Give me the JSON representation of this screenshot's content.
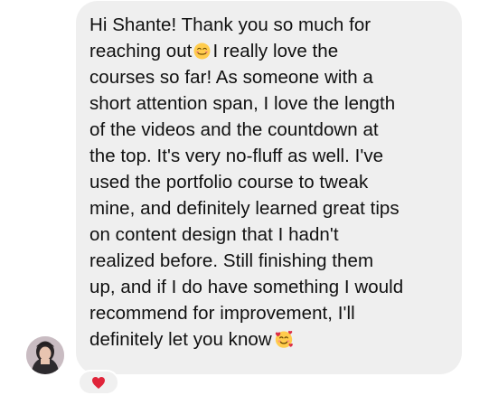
{
  "message": {
    "lines": [
      "Hi Shante! Thank you so much for",
      "reaching out",
      "I really love the",
      "courses so far! As someone with a",
      "short attention span, I love the length",
      "of the videos and the countdown at",
      "the top. It's very no-fluff as well. I've",
      "used the portfolio course to tweak",
      "mine, and definitely learned great tips",
      "on content design that I hadn't",
      "realized before. Still finishing them",
      "up, and if I do have something I would",
      "recommend for improvement, I'll",
      "definitely let you know"
    ],
    "inline_emojis": [
      "smiling-face-with-smiling-eyes-icon",
      "smiling-face-with-hearts-icon"
    ],
    "bubble_color": "#efefef",
    "text_color": "#101010"
  },
  "sender": {
    "avatar_icon": "user-avatar"
  },
  "reaction": {
    "icon": "red-heart-icon",
    "color": "#e0243a"
  }
}
